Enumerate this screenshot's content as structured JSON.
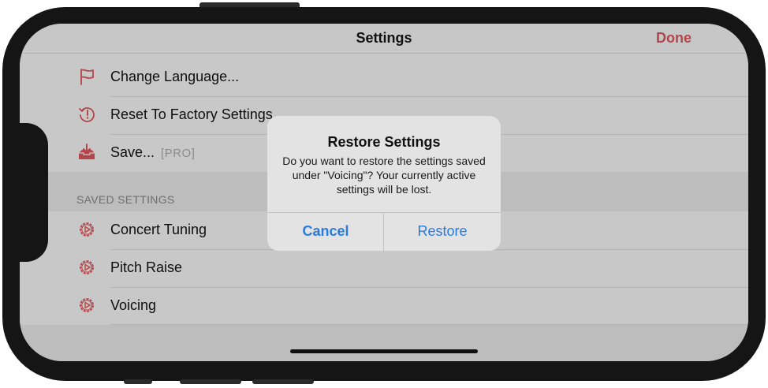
{
  "navbar": {
    "title": "Settings",
    "done_label": "Done"
  },
  "actions": [
    {
      "label": "Change Language...",
      "icon": "flag-icon"
    },
    {
      "label": "Reset To Factory Settings",
      "icon": "reset-clock-icon"
    },
    {
      "label": "Save...",
      "badge": "[PRO]",
      "icon": "save-tray-icon"
    }
  ],
  "saved_section": {
    "header": "SAVED SETTINGS",
    "items": [
      {
        "label": "Concert Tuning",
        "icon": "gear-play-icon"
      },
      {
        "label": "Pitch Raise",
        "icon": "gear-play-icon"
      },
      {
        "label": "Voicing",
        "icon": "gear-play-icon"
      }
    ]
  },
  "alert": {
    "title": "Restore Settings",
    "message": "Do you want to restore the settings saved under \"Voicing\"? Your currently active settings will be lost.",
    "cancel_label": "Cancel",
    "restore_label": "Restore"
  },
  "colors": {
    "accent_red": "#b4454a",
    "alert_blue": "#2a7be0"
  }
}
